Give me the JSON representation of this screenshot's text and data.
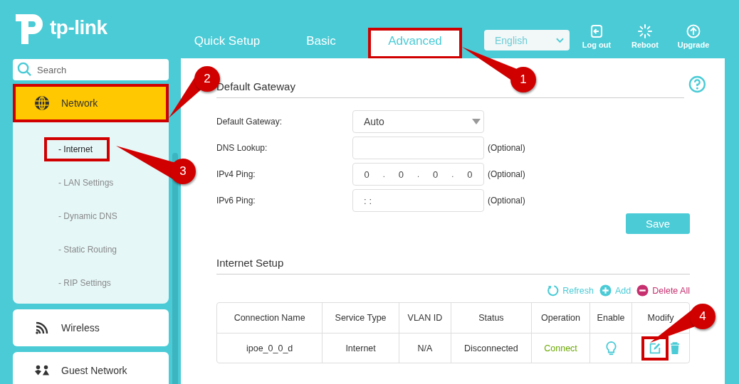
{
  "logo": {
    "text": "tp-link"
  },
  "nav_tabs": [
    {
      "label": "Quick Setup",
      "selected": false,
      "outlined": false
    },
    {
      "label": "Basic",
      "selected": false,
      "outlined": false
    },
    {
      "label": "Advanced",
      "selected": true,
      "outlined": true
    }
  ],
  "language": {
    "value": "English"
  },
  "header_actions": [
    {
      "kind": "logout",
      "label": "Log out"
    },
    {
      "kind": "reboot",
      "label": "Reboot"
    },
    {
      "kind": "upgrade",
      "label": "Upgrade"
    }
  ],
  "sidebar": {
    "search": {
      "placeholder": "Search"
    },
    "items": [
      {
        "kind": "network",
        "label": "Network",
        "selected": true,
        "expanded": true,
        "outlined": true,
        "children": [
          {
            "label": "- Internet",
            "selected": true,
            "outlined": true
          },
          {
            "label": "- LAN Settings",
            "selected": false,
            "outlined": false
          },
          {
            "label": "- Dynamic DNS",
            "selected": false,
            "outlined": false
          },
          {
            "label": "- Static Routing",
            "selected": false,
            "outlined": false
          },
          {
            "label": "- RIP Settings",
            "selected": false,
            "outlined": false
          }
        ]
      },
      {
        "kind": "wireless",
        "label": "Wireless",
        "selected": false,
        "expanded": false,
        "outlined": false
      },
      {
        "kind": "guest",
        "label": "Guest Network",
        "selected": false,
        "expanded": false,
        "outlined": false
      }
    ]
  },
  "default_gateway": {
    "title": "Default Gateway",
    "fields": [
      {
        "kind": "select",
        "label": "Default Gateway:",
        "value": "Auto"
      },
      {
        "kind": "text",
        "label": "DNS Lookup:",
        "note": "(Optional)"
      },
      {
        "kind": "ipv4",
        "label": "IPv4 Ping:",
        "octets": [
          "0",
          "0",
          "0",
          "0"
        ],
        "separator": ".",
        "note": "(Optional)"
      },
      {
        "kind": "text",
        "label": "IPv6 Ping:",
        "value": "::",
        "note": "(Optional)"
      }
    ],
    "save_button": "Save"
  },
  "internet_setup": {
    "title": "Internet Setup",
    "actions": [
      {
        "kind": "refresh",
        "label": "Refresh"
      },
      {
        "kind": "add",
        "label": "Add"
      },
      {
        "kind": "delete",
        "label": "Delete All"
      }
    ],
    "table": {
      "columns": [
        "Connection Name",
        "Service Type",
        "VLAN ID",
        "Status",
        "Operation",
        "Enable",
        "Modify"
      ],
      "rows": [
        {
          "connection_name": "ipoe_0_0_d",
          "service_type": "Internet",
          "vlan_id": "N/A",
          "status": "Disconnected",
          "operation": "Connect",
          "edit_outlined": true
        }
      ]
    }
  },
  "callouts": [
    {
      "number": "1"
    },
    {
      "number": "2"
    },
    {
      "number": "3"
    },
    {
      "number": "4"
    }
  ]
}
